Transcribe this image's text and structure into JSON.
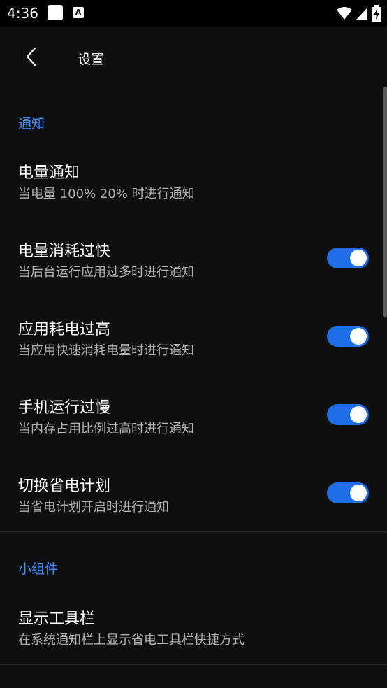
{
  "status_bar": {
    "time": "4:36",
    "icons": [
      "notification-square-icon",
      "a-icon",
      "wifi-icon",
      "signal-icon",
      "battery-charging-icon"
    ]
  },
  "toolbar": {
    "back_icon": "chevron-left-icon",
    "title": "设置"
  },
  "sections": {
    "notify": {
      "header": "通知",
      "items": [
        {
          "title": "电量通知",
          "subtitle": "当电量 100% 20% 时进行通知",
          "toggle": null
        },
        {
          "title": "电量消耗过快",
          "subtitle": "当后台运行应用过多时进行通知",
          "toggle": true
        },
        {
          "title": "应用耗电过高",
          "subtitle": "当应用快速消耗电量时进行通知",
          "toggle": true
        },
        {
          "title": "手机运行过慢",
          "subtitle": "当内存占用比例过高时进行通知",
          "toggle": true
        },
        {
          "title": "切换省电计划",
          "subtitle": "当省电计划开启时进行通知",
          "toggle": true
        }
      ]
    },
    "widget": {
      "header": "小组件",
      "items": [
        {
          "title": "显示工具栏",
          "subtitle": "在系统通知栏上显示省电工具栏快捷方式",
          "toggle": null
        }
      ]
    }
  },
  "colors": {
    "accent": "#3b8cff",
    "toggle_on": "#1e6ee8",
    "background": "#0f0f0f"
  }
}
